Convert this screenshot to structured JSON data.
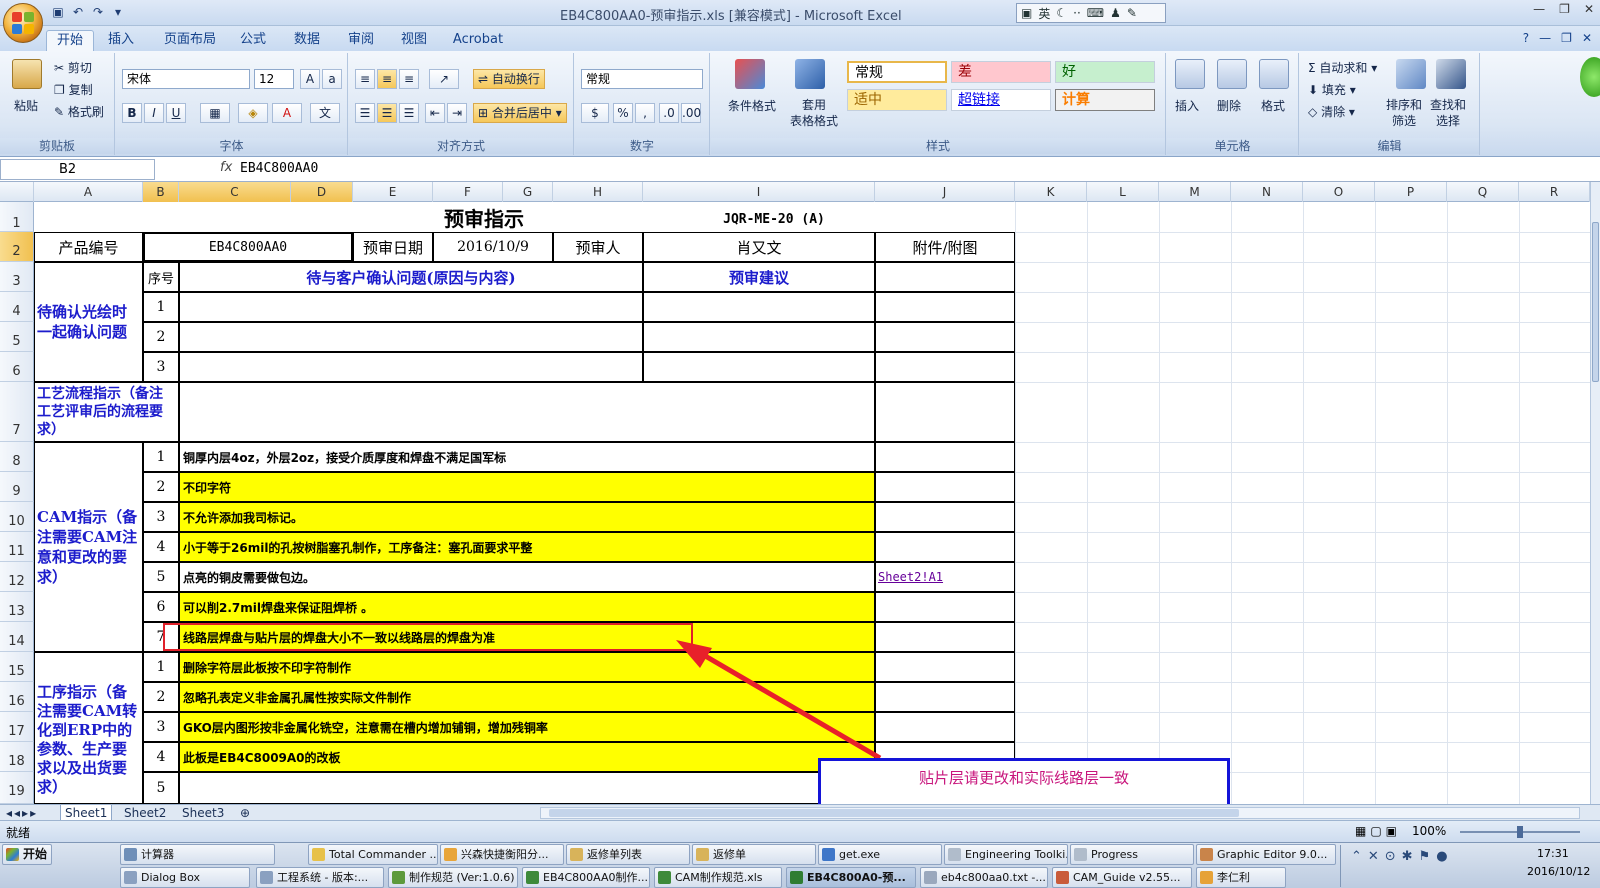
{
  "window": {
    "title": "EB4C800AA0-预审指示.xls [兼容模式] - Microsoft Excel",
    "ime": "英"
  },
  "ribbon_tabs": [
    "开始",
    "插入",
    "页面布局",
    "公式",
    "数据",
    "审阅",
    "视图",
    "Acrobat"
  ],
  "ribbon": {
    "clipboard": {
      "paste": "粘贴",
      "cut": "剪切",
      "copy": "复制",
      "format_painter": "格式刷",
      "label": "剪贴板"
    },
    "font": {
      "name": "宋体",
      "size": "12",
      "label": "字体",
      "bold": "B",
      "italic": "I",
      "underline": "U"
    },
    "alignment": {
      "wrap": "自动换行",
      "merge": "合并后居中",
      "label": "对齐方式"
    },
    "number": {
      "format": "常规",
      "percent": "%",
      "comma": ",",
      "label": "数字"
    },
    "styles": {
      "conditional": "条件格式",
      "table_format": "套用\n表格格式",
      "normal": "常规",
      "bad": "差",
      "good": "好",
      "neutral": "适中",
      "hyperlink": "超链接",
      "calc": "计算",
      "label": "样式"
    },
    "cells": {
      "insert": "插入",
      "delete": "删除",
      "format": "格式",
      "label": "单元格"
    },
    "editing": {
      "autosum": "自动求和",
      "fill": "填充",
      "clear": "清除",
      "sort": "排序和\n筛选",
      "find": "查找和\n选择",
      "label": "编辑"
    }
  },
  "formula_bar": {
    "name_box": "B2",
    "fx": "fx",
    "content": "EB4C800AA0"
  },
  "columns": [
    "A",
    "B",
    "C",
    "D",
    "E",
    "F",
    "G",
    "H",
    "I",
    "J",
    "K",
    "L",
    "M",
    "N",
    "O",
    "P",
    "Q",
    "R"
  ],
  "rows": [
    "1",
    "2",
    "3",
    "4",
    "5",
    "6",
    "7",
    "8",
    "9",
    "10",
    "11",
    "12",
    "13",
    "14",
    "15",
    "16",
    "17",
    "18",
    "19"
  ],
  "sheet": {
    "title": "预审指示",
    "doc_code": "JQR-ME-20 (A)",
    "product_label": "产品编号",
    "product_value": "EB4C800AA0",
    "date_label": "预审日期",
    "date_value": "2016/10/9",
    "reviewer_label": "预审人",
    "reviewer_value": "肖又文",
    "attach_label": "附件/附图",
    "seq_label": "序号",
    "issues_header": "待与客户确认问题(原因与内容)",
    "suggest_header": "预审建议",
    "confirm_section": "待确认光绘时一起确认问题",
    "confirm_nums": [
      "1",
      "2",
      "3"
    ],
    "process_section": "工艺流程指示（备注工艺评审后的流程要求）",
    "cam_section": "CAM指示（备注需要CAM注意和更改的要求）",
    "cam_items": [
      {
        "n": "1",
        "text": "铜厚内层4oz，外层2oz，接受介质厚度和焊盘不满足国军标"
      },
      {
        "n": "2",
        "text": "不印字符"
      },
      {
        "n": "3",
        "text": "不允许添加我司标记。"
      },
      {
        "n": "4",
        "text": "小于等于26mil的孔按树脂塞孔制作，工序备注：塞孔面要求平整"
      },
      {
        "n": "5",
        "text": "点亮的铜皮需要做包边。"
      },
      {
        "n": "6",
        "text": "可以削2.7mil焊盘来保证阻焊桥 。"
      },
      {
        "n": "7",
        "text": "线路层焊盘与贴片层的焊盘大小不一致以线路层的焊盘为准"
      }
    ],
    "link": "Sheet2!A1",
    "process2_section": "工序指示（备注需要CAM转化到ERP中的参数、生产要求以及出货要求）",
    "proc_items": [
      {
        "n": "1",
        "text": "删除字符层此板按不印字符制作"
      },
      {
        "n": "2",
        "text": "忽略孔表定义非金属孔属性按实际文件制作"
      },
      {
        "n": "3",
        "text": "GKO层内图形按非金属化铣空，注意需在槽内增加铺铜，增加残铜率"
      },
      {
        "n": "4",
        "text": "此板是EB4C8009A0的改板"
      },
      {
        "n": "5",
        "text": ""
      }
    ]
  },
  "annotation": {
    "callout": "贴片层请更改和实际线路层一致"
  },
  "sheet_tabs": [
    "Sheet1",
    "Sheet2",
    "Sheet3"
  ],
  "status": {
    "ready": "就绪",
    "zoom": "100%"
  },
  "taskbar": {
    "start": "开始",
    "row1": [
      "计算器",
      "Total Commander ...",
      "兴森快捷衡阳分...",
      "返修单列表",
      "返修单",
      "get.exe",
      "Engineering Toolki...",
      "Progress",
      "Graphic Editor 9.0..."
    ],
    "row2": [
      "Dialog Box",
      "工程系统 - 版本:...",
      "制作规范 (Ver:1.0.6)",
      "EB4C800AA0制作...",
      "CAM制作规范.xls",
      "EB4C800A0-预...",
      "eb4c800aa0.txt -...",
      "CAM_Guide v2.55...",
      "李仁利"
    ],
    "time": "17:31",
    "date": "2016/10/12"
  },
  "colors": {
    "accent": "#15428b",
    "highlight": "#ffff00",
    "arrow": "#e8202a",
    "callout_border": "#1414d8"
  }
}
